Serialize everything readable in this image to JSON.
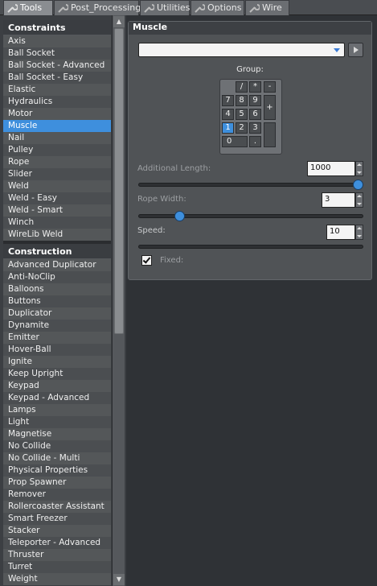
{
  "tabs": [
    {
      "label": "Tools",
      "active": true,
      "icon": "wrench-icon"
    },
    {
      "label": "Post_Processing",
      "active": false,
      "icon": "wrench-icon"
    },
    {
      "label": "Utilities",
      "active": false,
      "icon": "wrench-icon"
    },
    {
      "label": "Options",
      "active": false,
      "icon": "wrench-icon"
    },
    {
      "label": "Wire",
      "active": false,
      "icon": "wrench-icon"
    }
  ],
  "sidebar": {
    "constraints_header": "Constraints",
    "constraints": [
      "Axis",
      "Ball Socket",
      "Ball Socket - Advanced",
      "Ball Socket - Easy",
      "Elastic",
      "Hydraulics",
      "Motor",
      "Muscle",
      "Nail",
      "Pulley",
      "Rope",
      "Slider",
      "Weld",
      "Weld - Easy",
      "Weld - Smart",
      "Winch",
      "WireLib Weld"
    ],
    "selected": "Muscle",
    "construction_header": "Construction",
    "construction": [
      "Advanced Duplicator",
      "Anti-NoClip",
      "Balloons",
      "Buttons",
      "Duplicator",
      "Dynamite",
      "Emitter",
      "Hover-Ball",
      "Ignite",
      "Keep Upright",
      "Keypad",
      "Keypad - Advanced",
      "Lamps",
      "Light",
      "Magnetise",
      "No Collide",
      "No Collide - Multi",
      "Physical Properties",
      "Prop Spawner",
      "Remover",
      "Rollercoaster Assistant",
      "Smart Freezer",
      "Stacker",
      "Teleporter - Advanced",
      "Thruster",
      "Turret",
      "Weight"
    ]
  },
  "panel": {
    "title": "Muscle",
    "dropdown_value": "",
    "group_label": "Group:",
    "keypad": {
      "keys": [
        "/",
        "*",
        "-",
        "7",
        "8",
        "9",
        "+",
        "4",
        "5",
        "6",
        "1",
        "2",
        "3",
        "0",
        "."
      ],
      "selected": "1"
    },
    "additional_length": {
      "label": "Additional Length:",
      "value": "1000",
      "fraction": 1.0
    },
    "rope_width": {
      "label": "Rope Width:",
      "value": "3",
      "fraction": 0.17
    },
    "speed": {
      "label": "Speed:",
      "value": "10"
    },
    "fixed": {
      "label": "Fixed:",
      "checked": true
    }
  },
  "colors": {
    "accent": "#3e8fdd",
    "background": "#2f3236",
    "panel": "#505356"
  }
}
